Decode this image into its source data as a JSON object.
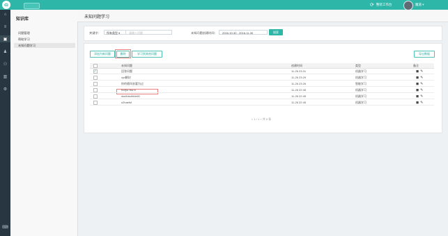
{
  "topbar": {
    "button_label": "",
    "workbench_label": "整装工作台",
    "user_name": "魔道",
    "user_arrow": "▾"
  },
  "leftnav": {
    "icons": [
      "⌂",
      "≡",
      "▣",
      "♟",
      "⚇",
      "▥",
      "⚙",
      "⌨"
    ]
  },
  "sidebar": {
    "title": "知识库",
    "items": [
      {
        "label": "问题管理"
      },
      {
        "label": "帮助学习"
      },
      {
        "label": "未知问题学习"
      }
    ]
  },
  "header": {
    "title": "未知问题学习"
  },
  "filters": {
    "keyword_label": "关键字：",
    "type_value": "所有类型 ▾",
    "keyword_placeholder": "请输入问题",
    "date_label": "未知问题创建时间：",
    "date_range": "2016-10-30 - 2016-11-30",
    "search_button": "搜索"
  },
  "actions": {
    "add_known": "添加为新问题",
    "delete": "删除",
    "learn_other": "学习到其他问题",
    "export": "导出数据"
  },
  "table": {
    "headers": [
      "",
      "未知问题",
      "创建时间",
      "类型",
      "备注"
    ],
    "rows": [
      {
        "question": "回答问题",
        "time": "11-26 23:31",
        "type": "机器学习",
        "checked": true
      },
      {
        "question": "xjvi解封",
        "time": "11-26 23:29",
        "type": "机器学习",
        "checked": false
      },
      {
        "question": "你的随叫非要为过",
        "time": "11-26 23:26",
        "type": "智能学习",
        "checked": false
      },
      {
        "question": "fccfjsr fsw e",
        "time": "11-26 22:45",
        "type": "机器学习",
        "checked": false
      },
      {
        "question": "dseifdsdhfdeli0",
        "time": "11-26 22:45",
        "type": "机器学习",
        "checked": false
      },
      {
        "question": "s2haefsf",
        "time": "11-26 22:45",
        "type": "机器学习",
        "checked": false
      }
    ],
    "row_action_icons": [
      "◼",
      "✎"
    ]
  },
  "pager": {
    "text": "< 1 / 1 >  共 6 条"
  }
}
